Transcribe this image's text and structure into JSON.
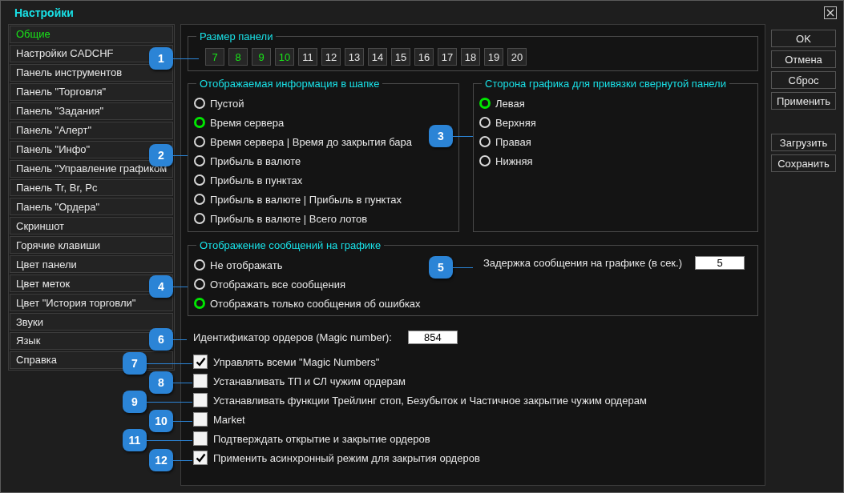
{
  "window": {
    "title": "Настройки"
  },
  "sidebar": {
    "items": [
      {
        "label": "Общие",
        "selected": true
      },
      {
        "label": "Настройки CADCHF",
        "selected": false
      },
      {
        "label": "Панель инструментов",
        "selected": false
      },
      {
        "label": "Панель \"Торговля\"",
        "selected": false
      },
      {
        "label": "Панель \"Задания\"",
        "selected": false
      },
      {
        "label": "Панель \"Алерт\"",
        "selected": false
      },
      {
        "label": "Панель \"Инфо\"",
        "selected": false
      },
      {
        "label": "Панель \"Управление графиком",
        "selected": false
      },
      {
        "label": "Панель Tr, Br, Pc",
        "selected": false
      },
      {
        "label": "Панель \"Ордера\"",
        "selected": false
      },
      {
        "label": "Скриншот",
        "selected": false
      },
      {
        "label": "Горячие клавиши",
        "selected": false
      },
      {
        "label": "Цвет панели",
        "selected": false
      },
      {
        "label": "Цвет меток",
        "selected": false
      },
      {
        "label": "Цвет \"История торговли\"",
        "selected": false
      },
      {
        "label": "Звуки",
        "selected": false
      },
      {
        "label": "Язык",
        "selected": false
      },
      {
        "label": "Справка",
        "selected": false
      }
    ]
  },
  "panel_size": {
    "title": "Размер панели",
    "options": [
      {
        "label": "7",
        "available": true
      },
      {
        "label": "8",
        "available": true
      },
      {
        "label": "9",
        "available": true
      },
      {
        "label": "10",
        "available": true
      },
      {
        "label": "11",
        "available": false
      },
      {
        "label": "12",
        "available": false
      },
      {
        "label": "13",
        "available": false
      },
      {
        "label": "14",
        "available": false
      },
      {
        "label": "15",
        "available": false
      },
      {
        "label": "16",
        "available": false
      },
      {
        "label": "17",
        "available": false
      },
      {
        "label": "18",
        "available": false
      },
      {
        "label": "19",
        "available": false
      },
      {
        "label": "20",
        "available": false
      }
    ]
  },
  "header_info": {
    "title": "Отображаемая информация в шапке",
    "options": [
      {
        "label": "Пустой",
        "selected": false
      },
      {
        "label": "Время сервера",
        "selected": true
      },
      {
        "label": "Время сервера | Время до закрытия бара",
        "selected": false
      },
      {
        "label": "Прибыль в валюте",
        "selected": false
      },
      {
        "label": "Прибыль в пунктах",
        "selected": false
      },
      {
        "label": "Прибыль в валюте | Прибыль в пунктах",
        "selected": false
      },
      {
        "label": "Прибыль в валюте | Всего лотов",
        "selected": false
      }
    ]
  },
  "collapse_side": {
    "title": "Сторона графика для привязки свернутой панели",
    "options": [
      {
        "label": "Левая",
        "selected": true
      },
      {
        "label": "Верхняя",
        "selected": false
      },
      {
        "label": "Правая",
        "selected": false
      },
      {
        "label": "Нижняя",
        "selected": false
      }
    ]
  },
  "messages": {
    "title": "Отображение сообщений на графике",
    "options": [
      {
        "label": "Не отображать",
        "selected": false
      },
      {
        "label": "Отображать все сообщения",
        "selected": false
      },
      {
        "label": "Отображать только сообщения об ошибках",
        "selected": true
      }
    ],
    "delay_label": "Задержка сообщения на графике (в сек.)",
    "delay_value": "5"
  },
  "magic": {
    "label": "Идентификатор ордеров (Magic number):",
    "value": "854"
  },
  "checkboxes": [
    {
      "label": "Управлять всеми \"Magic Numbers\"",
      "checked": true
    },
    {
      "label": "Устанавливать ТП и СЛ чужим ордерам",
      "checked": false
    },
    {
      "label": "Устанавливать функции Трейлинг стоп, Безубыток и Частичное закрытие чужим ордерам",
      "checked": false
    },
    {
      "label": "Market",
      "checked": false
    },
    {
      "label": "Подтверждать открытие и закрытие ордеров",
      "checked": false
    },
    {
      "label": "Применить асинхронный режим для закрытия ордеров",
      "checked": true
    }
  ],
  "buttons_top": [
    {
      "label": "OK"
    },
    {
      "label": "Отмена"
    },
    {
      "label": "Сброс"
    },
    {
      "label": "Применить"
    }
  ],
  "buttons_bottom": [
    {
      "label": "Загрузить"
    },
    {
      "label": "Сохранить"
    }
  ],
  "callouts": [
    {
      "label": "1"
    },
    {
      "label": "2"
    },
    {
      "label": "3"
    },
    {
      "label": "4"
    },
    {
      "label": "5"
    },
    {
      "label": "6"
    },
    {
      "label": "7"
    },
    {
      "label": "8"
    },
    {
      "label": "9"
    },
    {
      "label": "10"
    },
    {
      "label": "11"
    },
    {
      "label": "12"
    }
  ]
}
